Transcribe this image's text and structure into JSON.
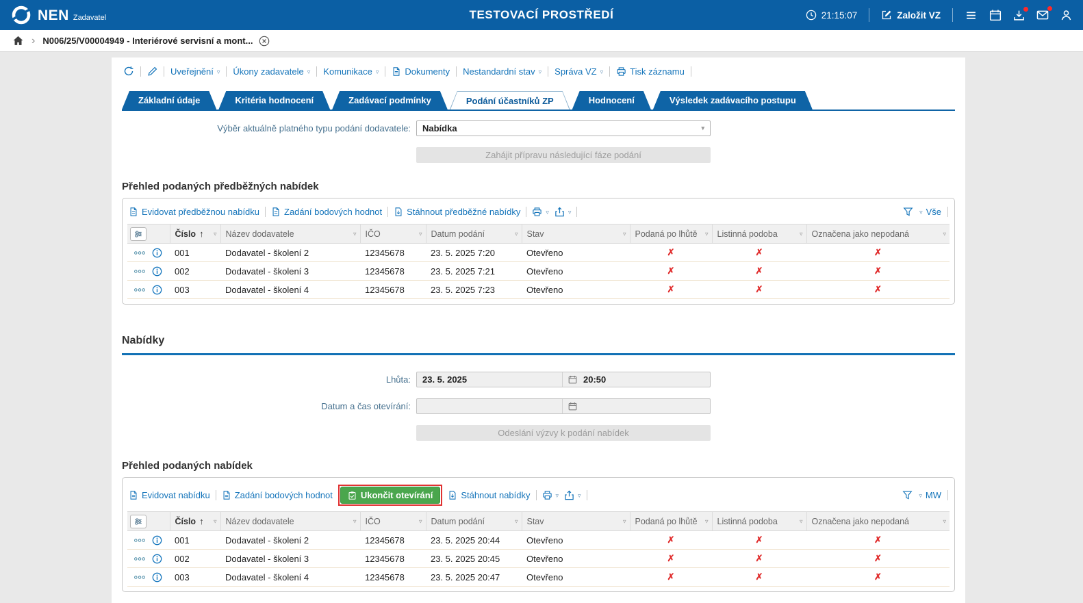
{
  "topbar": {
    "brand": "NEN",
    "brand_sub": "Zadavatel",
    "env_title": "TESTOVACÍ PROSTŘEDÍ",
    "time": "21:15:07",
    "zalozit_vz_label": "Založit VZ"
  },
  "breadcrumb": {
    "record_label": "N006/25/V00004949 - Interiérové servisní a mont..."
  },
  "record_toolbar": {
    "uverejneni": "Uveřejnění",
    "ukony_zadavatele": "Úkony zadavatele",
    "komunikace": "Komunikace",
    "dokumenty": "Dokumenty",
    "nestandardni_stav": "Nestandardní stav",
    "sprava_vz": "Správa VZ",
    "tisk_zaznamu": "Tisk záznamu"
  },
  "tabs": {
    "zakladni_udaje": "Základní údaje",
    "kriteria_hodnoceni": "Kritéria hodnocení",
    "zadavaci_podminky": "Zadávací podmínky",
    "podani_ucastniku": "Podání účastníků ZP",
    "hodnoceni": "Hodnocení",
    "vysledek": "Výsledek zadávacího postupu"
  },
  "submission_form": {
    "type_label": "Výběr aktuálně platného typu podání dodavatele:",
    "type_value": "Nabídka",
    "next_phase_button": "Zahájit přípravu následující fáze podání"
  },
  "columns": {
    "cislo": "Číslo",
    "nazev": "Název dodavatele",
    "ico": "IČO",
    "datum": "Datum podání",
    "stav": "Stav",
    "po_lhute": "Podaná po lhůtě",
    "listinna": "Listinná podoba",
    "nepodana": "Označena jako nepodaná"
  },
  "preliminary_offers": {
    "title": "Přehled podaných předběžných nabídek",
    "toolbar": {
      "evidovat": "Evidovat předběžnou nabídku",
      "zadani_bodovych": "Zadání bodových hodnot",
      "stahnout": "Stáhnout předběžné nabídky",
      "view": "Vše"
    },
    "rows": [
      {
        "cislo": "001",
        "nazev": "Dodavatel - školení 2",
        "ico": "12345678",
        "datum": "23. 5. 2025 7:20",
        "stav": "Otevřeno",
        "po_lhute": "✗",
        "listinna": "✗",
        "nepodana": "✗"
      },
      {
        "cislo": "002",
        "nazev": "Dodavatel - školení 3",
        "ico": "12345678",
        "datum": "23. 5. 2025 7:21",
        "stav": "Otevřeno",
        "po_lhute": "✗",
        "listinna": "✗",
        "nepodana": "✗"
      },
      {
        "cislo": "003",
        "nazev": "Dodavatel - školení 4",
        "ico": "12345678",
        "datum": "23. 5. 2025 7:23",
        "stav": "Otevřeno",
        "po_lhute": "✗",
        "listinna": "✗",
        "nepodana": "✗"
      }
    ]
  },
  "offers_section": {
    "title": "Nabídky",
    "deadline_label": "Lhůta:",
    "deadline_date": "23. 5. 2025",
    "deadline_time": "20:50",
    "opening_label": "Datum a čas otevírání:",
    "opening_date": "",
    "opening_time": "",
    "send_invitation_button": "Odeslání výzvy k podání nabídek"
  },
  "offers": {
    "title": "Přehled podaných nabídek",
    "toolbar": {
      "evidovat": "Evidovat nabídku",
      "zadani_bodovych": "Zadání bodových hodnot",
      "ukoncit_oteviranì": "Ukončit otevírání",
      "stahnout": "Stáhnout nabídky",
      "view": "MW"
    },
    "rows": [
      {
        "cislo": "001",
        "nazev": "Dodavatel - školení 2",
        "ico": "12345678",
        "datum": "23. 5. 2025 20:44",
        "stav": "Otevřeno",
        "po_lhute": "✗",
        "listinna": "✗",
        "nepodana": "✗"
      },
      {
        "cislo": "002",
        "nazev": "Dodavatel - školení 3",
        "ico": "12345678",
        "datum": "23. 5. 2025 20:45",
        "stav": "Otevřeno",
        "po_lhute": "✗",
        "listinna": "✗",
        "nepodana": "✗"
      },
      {
        "cislo": "003",
        "nazev": "Dodavatel - školení 4",
        "ico": "12345678",
        "datum": "23. 5. 2025 20:47",
        "stav": "Otevřeno",
        "po_lhute": "✗",
        "listinna": "✗",
        "nepodana": "✗"
      }
    ]
  },
  "icons": {
    "dropdown_chevron": "▿",
    "select_chevron": "▾",
    "sort_ascending": "↑",
    "breadcrumb_chevron": "›"
  },
  "colors": {
    "topbar_blue": "#0b5fa4",
    "link_blue": "#1474ba",
    "green_button": "#4aa64d",
    "highlight_red": "#e03131",
    "x_mark_red": "#e02b2b"
  }
}
